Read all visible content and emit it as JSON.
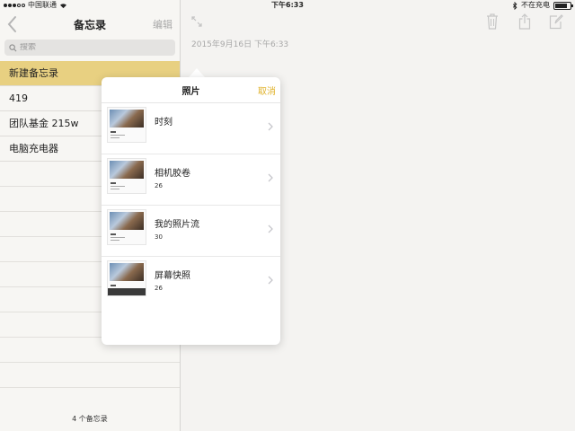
{
  "status_bar": {
    "carrier": "中国联通",
    "time": "下午6:33",
    "charge_status": "不在充电",
    "battery_level": 0.8
  },
  "sidebar": {
    "title": "备忘录",
    "edit_label": "编辑",
    "search_placeholder": "搜索",
    "notes": [
      {
        "title": "新建备忘录",
        "selected": true
      },
      {
        "title": "419",
        "selected": false
      },
      {
        "title": "团队基金 215w",
        "selected": false
      },
      {
        "title": "电脑充电器",
        "selected": false
      }
    ],
    "footer": "4 个备忘录"
  },
  "main": {
    "date": "2015年9月16日 下午6:33"
  },
  "popover": {
    "title": "照片",
    "cancel_label": "取消",
    "albums": [
      {
        "name": "时刻",
        "count": ""
      },
      {
        "name": "相机胶卷",
        "count": "26"
      },
      {
        "name": "我的照片流",
        "count": "30"
      },
      {
        "name": "屏幕快照",
        "count": "26"
      }
    ]
  },
  "colors": {
    "accent": "#e0b22b",
    "selected_row": "#e8d081"
  },
  "icons": {
    "back": "chevron-left-icon",
    "search": "search-icon",
    "expand": "expand-icon",
    "trash": "trash-icon",
    "share": "share-icon",
    "compose": "compose-icon",
    "chevron": "chevron-right-icon"
  }
}
